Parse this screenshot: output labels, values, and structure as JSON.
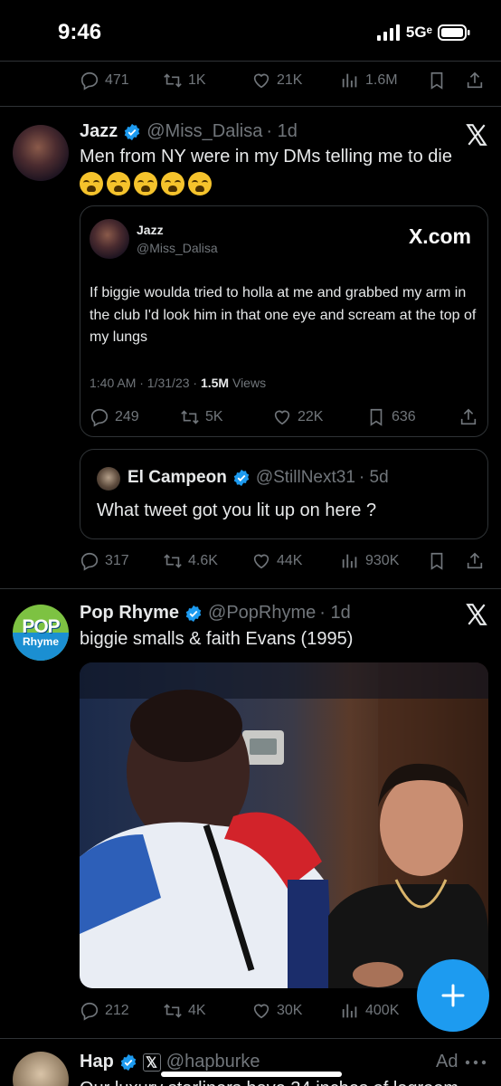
{
  "status_bar": {
    "time": "9:46",
    "network": "5Gᵉ"
  },
  "prev_tweet": {
    "replies": "471",
    "retweets": "1K",
    "likes": "21K",
    "views": "1.6M"
  },
  "tweet1": {
    "name": "Jazz",
    "handle": "@Miss_Dalisa",
    "time": "· 1d",
    "text": "Men from NY were in my DMs telling me to die",
    "emoji_count": 5,
    "quote": {
      "name": "Jazz",
      "handle": "@Miss_Dalisa",
      "source": "X.com",
      "text": "If biggie woulda tried to holla at me and grabbed my arm in the club I'd look him in that one eye and scream at the top of my lungs",
      "meta_date": "1:40 AM · 1/31/23 · ",
      "meta_views_num": "1.5M",
      "meta_views_label": " Views",
      "replies": "249",
      "retweets": "5K",
      "likes": "22K",
      "bookmarks": "636"
    },
    "nested_quote": {
      "name": "El Campeon",
      "handle": "@StillNext31",
      "time": "· 5d",
      "text": "What tweet got you lit up on here ?"
    },
    "replies": "317",
    "retweets": "4.6K",
    "likes": "44K",
    "views": "930K"
  },
  "tweet2": {
    "avatar_top": "POP",
    "avatar_bottom": "Rhyme",
    "name": "Pop Rhyme",
    "handle": "@PopRhyme",
    "time": "· 1d",
    "text": "biggie smalls & faith Evans (1995)",
    "replies": "212",
    "retweets": "4K",
    "likes": "30K",
    "views": "400K"
  },
  "tweet3": {
    "name": "Hap",
    "handle": "@hapburke",
    "ad_label": "Ad",
    "text": "Our luxury starliners have 34 inches of legroom"
  },
  "colors": {
    "accent": "#1d9bf0",
    "muted": "#71767b",
    "text": "#e7e9ea",
    "border": "#2f3336"
  }
}
